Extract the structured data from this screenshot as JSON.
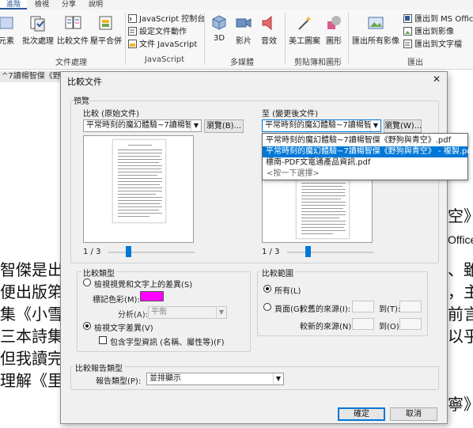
{
  "ribbon": {
    "tabs": [
      "進階",
      "檢視",
      "分享",
      "說明"
    ],
    "active_tab": "進階",
    "buttons": {
      "elements": "元素",
      "batch": "批次處理",
      "compare": "比較文件",
      "compress": "壓平合併",
      "js_console": "JavaScript 控制台",
      "set_action": "設定文件動作",
      "doc_js": "文件 JavaScript",
      "three_d": "3D",
      "video": "影片",
      "audio": "音效",
      "art": "美工圖案",
      "shape": "圖形",
      "export_images": "匯出所有影像",
      "export_ms": "匯出到 MS Office",
      "export_img": "匯出到影像",
      "export_txt": "匯出到文字檔"
    },
    "groups": {
      "doc_processing": "文件處理",
      "javascript": "JavaScript",
      "multimedia": "多媒體",
      "clipart": "剪貼簿和圖形",
      "export": "匯出"
    }
  },
  "document": {
    "tab_title": "^7讀楊智傑《野狗",
    "visible_text": [
      "智傑是出",
      "便出版笫",
      "集《小雪",
      "三本詩集",
      "但我讀完",
      "理解《里",
      "、雖",
      "，主",
      "前言",
      "以乎",
      "寧》",
      "空》",
      "Office"
    ]
  },
  "dialog": {
    "title": "比較文件",
    "close": "✕",
    "preview_group": "預覽",
    "compare_original_label": "比較 (原始文件)",
    "compare_changed_label": "至 (變更後文件)",
    "original_file": "平常時刻的魔幻體驗~7讀楊智傑",
    "changed_file": "平常時刻的魔幻體驗~7讀楊智傑",
    "browse_b": "瀏覽(B)...",
    "browse_w": "瀏覽(W)...",
    "page_left": "1 / 3",
    "page_right": "1 / 3",
    "dropdown_items": [
      "平常時刻的魔幻體驗~7讀楊智傑《野狗與青空》.pdf",
      "平常時刻的魔幻體驗~7讀楊智傑《野狗與青空》 - 複製.pdf",
      "標南-PDF文電通產品資訊.pdf",
      "<按一下選擇>"
    ],
    "selected_dropdown_item": 1,
    "compare_type_group": "比較類型",
    "radio_visual": "檢視視覺和文字上的差異(S)",
    "mark_color_label": "標記色彩(M):",
    "mark_color": "#ff00ff",
    "analysis_label": "分析(A):",
    "analysis_value": "平衡",
    "radio_text": "檢視文字差異(V)",
    "checkbox_format": "包含字型資訊 (名稱、屬性等)(F)",
    "compare_range_group": "比較範圍",
    "radio_all": "所有(L)",
    "radio_pages": "頁面(G)",
    "older_source": "較舊的來源(I):",
    "newer_source": "較新的來源(N):",
    "to_r": "到(T):",
    "to_o": "到(O):",
    "report_group": "比較報告類型",
    "report_type_label": "報告類型(P):",
    "report_type_value": "並排顯示",
    "ok": "確定",
    "cancel": "取消"
  },
  "colors": {
    "accent": "#0078d7",
    "mark": "#ff00ff"
  }
}
